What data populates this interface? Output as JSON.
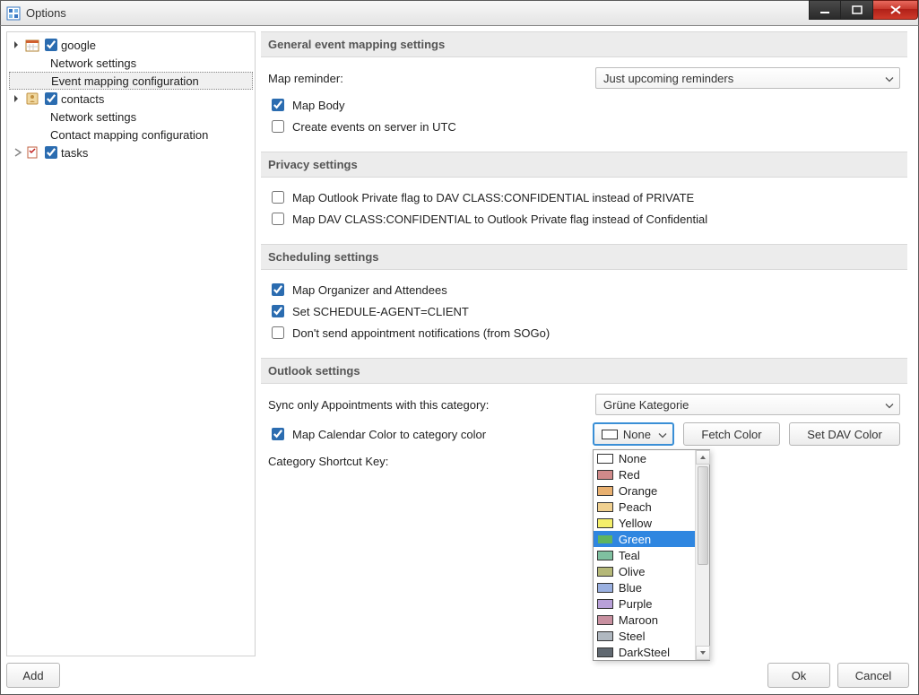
{
  "window": {
    "title": "Options"
  },
  "tree": {
    "google": {
      "label": "google",
      "expanded": true,
      "checked": true,
      "children": {
        "network": "Network settings",
        "eventmapping": "Event mapping configuration"
      }
    },
    "contacts": {
      "label": "contacts",
      "expanded": true,
      "checked": true,
      "children": {
        "network": "Network settings",
        "contactmapping": "Contact mapping configuration"
      }
    },
    "tasks": {
      "label": "tasks",
      "expanded": false,
      "checked": true
    },
    "selected": "google.eventmapping"
  },
  "sections": {
    "general": {
      "title": "General event mapping settings",
      "map_reminder_label": "Map reminder:",
      "map_reminder_value": "Just upcoming reminders",
      "map_body": {
        "label": "Map Body",
        "checked": true
      },
      "create_utc": {
        "label": "Create events on server in UTC",
        "checked": false
      }
    },
    "privacy": {
      "title": "Privacy settings",
      "opt1": {
        "label": "Map Outlook Private flag to DAV CLASS:CONFIDENTIAL instead of PRIVATE",
        "checked": false
      },
      "opt2": {
        "label": "Map DAV CLASS:CONFIDENTIAL to Outlook Private flag instead of Confidential",
        "checked": false
      }
    },
    "scheduling": {
      "title": "Scheduling settings",
      "opt1": {
        "label": "Map Organizer and Attendees",
        "checked": true
      },
      "opt2": {
        "label": "Set SCHEDULE-AGENT=CLIENT",
        "checked": true
      },
      "opt3": {
        "label": "Don't send appointment notifications (from SOGo)",
        "checked": false
      }
    },
    "outlook": {
      "title": "Outlook settings",
      "sync_category_label": "Sync only Appointments with this category:",
      "sync_category_value": "Grüne Kategorie",
      "map_color": {
        "label": "Map Calendar Color to category color",
        "checked": true
      },
      "category_shortcut_label": "Category Shortcut Key:",
      "color_combo_value": "None",
      "fetch_color_label": "Fetch Color",
      "set_dav_color_label": "Set DAV Color"
    }
  },
  "color_options": [
    {
      "name": "None",
      "color": "#ffffff"
    },
    {
      "name": "Red",
      "color": "#d08a8a"
    },
    {
      "name": "Orange",
      "color": "#e8b070"
    },
    {
      "name": "Peach",
      "color": "#f0d090"
    },
    {
      "name": "Yellow",
      "color": "#f5ef6a"
    },
    {
      "name": "Green",
      "color": "#5fb45f",
      "selected": true
    },
    {
      "name": "Teal",
      "color": "#7fc0a0"
    },
    {
      "name": "Olive",
      "color": "#b5b878"
    },
    {
      "name": "Blue",
      "color": "#9ab0e0"
    },
    {
      "name": "Purple",
      "color": "#b8a0d8"
    },
    {
      "name": "Maroon",
      "color": "#c890a0"
    },
    {
      "name": "Steel",
      "color": "#b0b8c0"
    },
    {
      "name": "DarkSteel",
      "color": "#606870"
    }
  ],
  "buttons": {
    "add": "Add",
    "ok": "Ok",
    "cancel": "Cancel"
  }
}
